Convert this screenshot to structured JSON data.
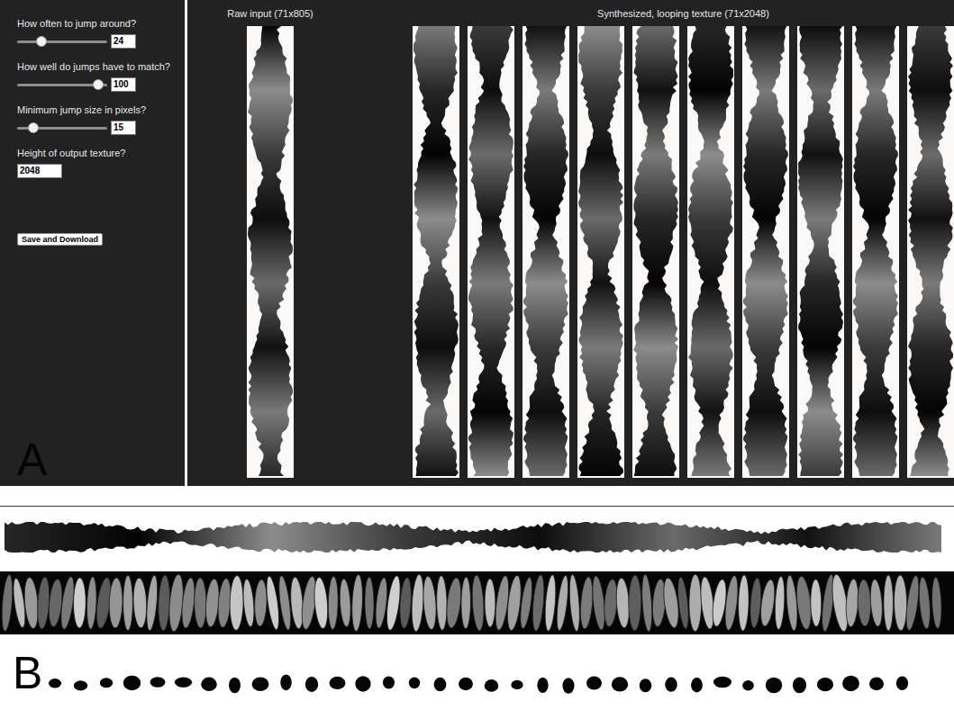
{
  "panel_a": {
    "label": "A",
    "controls": [
      {
        "label": "How often to jump around?",
        "kind": "slider",
        "level": 0.27,
        "value": "24"
      },
      {
        "label": "How well do jumps have to match?",
        "kind": "slider",
        "level": 0.9,
        "value": "100"
      },
      {
        "label": "Minimum jump size in pixels?",
        "kind": "slider",
        "level": 0.18,
        "value": "15"
      },
      {
        "label": "Height of output texture?",
        "kind": "field",
        "value": "2048"
      }
    ],
    "button": "Save and Download",
    "raw_input": {
      "title": "Raw input (71x805)"
    },
    "synthesized": {
      "title": "Synthesized, looping texture (71x2048)"
    }
  },
  "panel_b": {
    "label": "B",
    "textures": [
      {
        "kind": "silhouette"
      },
      {
        "kind": "grains"
      },
      {
        "kind": "dots"
      }
    ]
  }
}
